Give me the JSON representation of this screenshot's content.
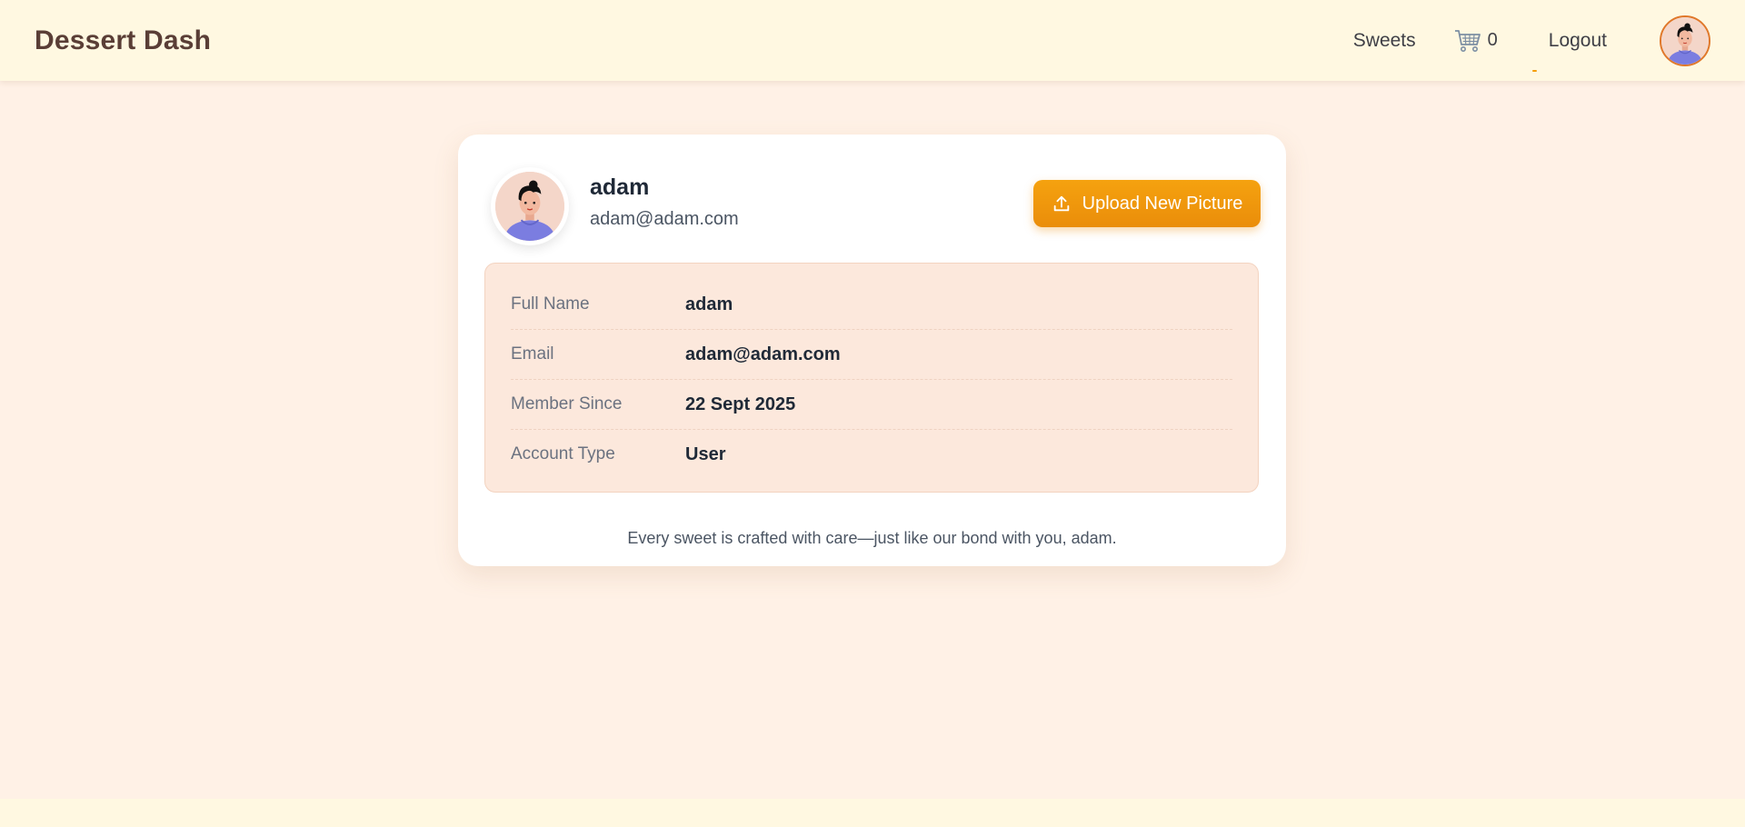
{
  "nav": {
    "brand": "Dessert Dash",
    "sweets_label": "Sweets",
    "cart_count": "0",
    "logout_label": "Logout",
    "accent_color": "#f59e0b"
  },
  "profile": {
    "name": "adam",
    "email": "adam@adam.com",
    "upload_label": "Upload New Picture"
  },
  "details": [
    {
      "label": "Full Name",
      "value": "adam"
    },
    {
      "label": "Email",
      "value": "adam@adam.com"
    },
    {
      "label": "Member Since",
      "value": "22 Sept 2025"
    },
    {
      "label": "Account Type",
      "value": "User"
    }
  ],
  "tagline": "Every sweet is crafted with care—just like our bond with you, adam.",
  "icons": [
    "cart-icon",
    "upload-icon",
    "avatar"
  ],
  "colors": {
    "page_bg": "#fff1e6",
    "navbar_bg": "#fff8e1",
    "button": "#f59e0b",
    "brand_text": "#5a3e36",
    "info_bg": "#fce8dc"
  }
}
